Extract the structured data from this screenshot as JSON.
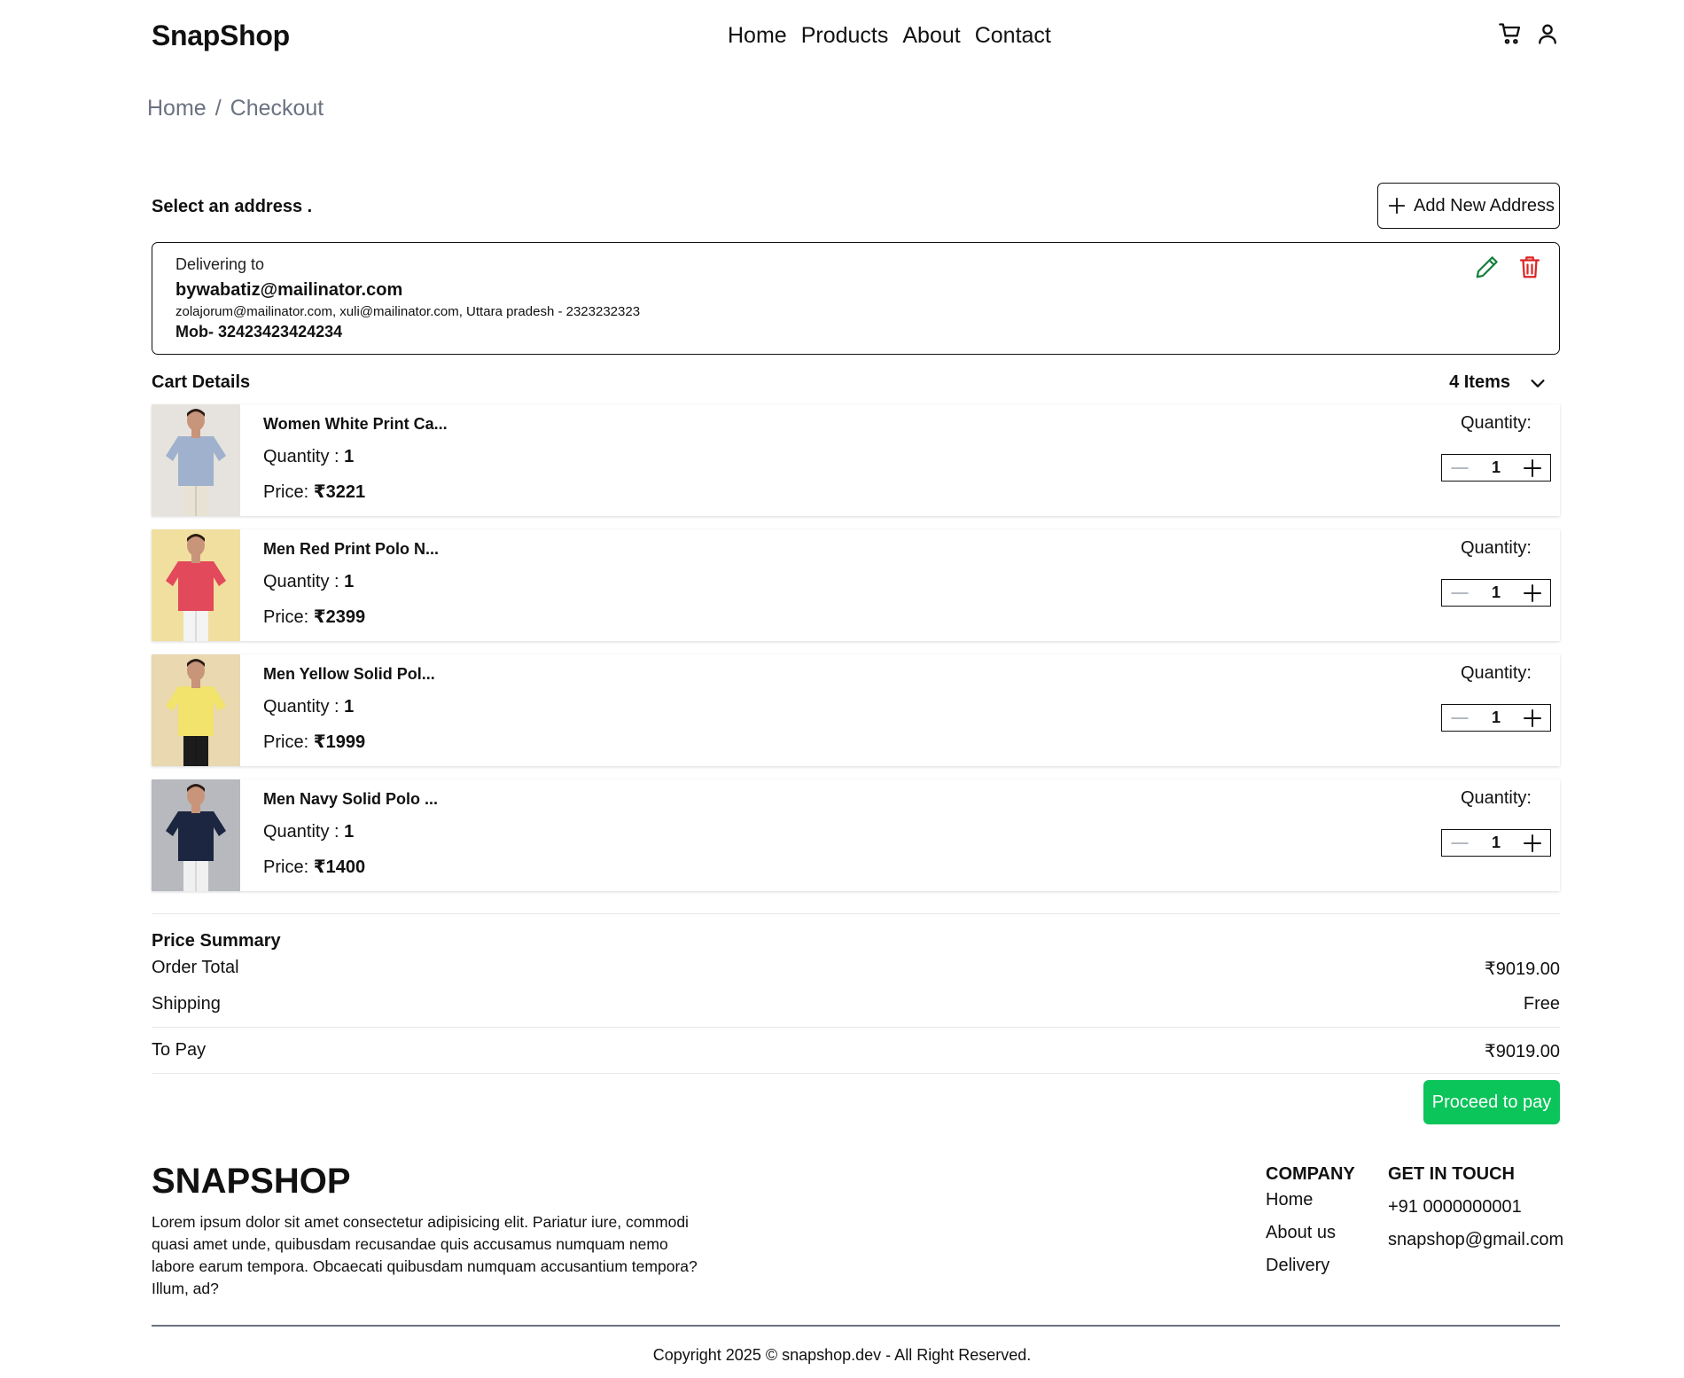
{
  "header": {
    "logo": "SnapShop",
    "nav": [
      "Home",
      "Products",
      "About",
      "Contact"
    ],
    "icons": [
      "cart-icon",
      "user-icon"
    ]
  },
  "breadcrumb": {
    "home": "Home",
    "sep": "/",
    "current": "Checkout"
  },
  "address": {
    "section_title": "Select an address .",
    "add_button": "Add New Address",
    "label": "Delivering to",
    "email": "bywabatiz@mailinator.com",
    "line": "zolajorum@mailinator.com, xuli@mailinator.com, Uttara pradesh - 2323232323",
    "mobile": "Mob- 32423423424234",
    "edit_color": "#15803d",
    "delete_color": "#dc2626"
  },
  "cart": {
    "title": "Cart Details",
    "count": "4 Items",
    "quantity_label": "Quantity:",
    "items": [
      {
        "name": "Women White Print Ca...",
        "qty_label": "Quantity : ",
        "qty": "1",
        "price_label": "Price: ",
        "price": "₹3221",
        "stepper": "1",
        "shirt": "#9fb1cc",
        "bg": "#e6e3de",
        "pants": "#e8e2d4"
      },
      {
        "name": "Men Red Print Polo N...",
        "qty_label": "Quantity : ",
        "qty": "1",
        "price_label": "Price: ",
        "price": "₹2399",
        "stepper": "1",
        "shirt": "#e2495a",
        "bg": "#f1dfa0",
        "pants": "#f3f3f3"
      },
      {
        "name": "Men Yellow Solid Pol...",
        "qty_label": "Quantity : ",
        "qty": "1",
        "price_label": "Price: ",
        "price": "₹1999",
        "stepper": "1",
        "shirt": "#f2e36c",
        "bg": "#e9d8b0",
        "pants": "#1b1b1b"
      },
      {
        "name": "Men Navy Solid Polo ...",
        "qty_label": "Quantity : ",
        "qty": "1",
        "price_label": "Price: ",
        "price": "₹1400",
        "stepper": "1",
        "shirt": "#1d2640",
        "bg": "#b7b9be",
        "pants": "#f0f0f0"
      }
    ]
  },
  "summary": {
    "title": "Price Summary",
    "order_total_label": "Order Total",
    "order_total": "₹9019.00",
    "shipping_label": "Shipping",
    "shipping": "Free",
    "to_pay_label": "To Pay",
    "to_pay": "₹9019.00",
    "pay_button": "Proceed to pay",
    "pay_color": "#0bc45a"
  },
  "footer": {
    "brand": "SNAPSHOP",
    "description": "Lorem ipsum dolor sit amet consectetur adipisicing elit. Pariatur iure, commodi quasi amet unde, quibusdam recusandae quis accusamus numquam nemo labore earum tempora. Obcaecati quibusdam numquam accusantium tempora? Illum, ad?",
    "company_title": "COMPANY",
    "company_links": [
      "Home",
      "About us",
      "Delivery"
    ],
    "contact_title": "GET IN TOUCH",
    "phone": "+91 0000000001",
    "email": "snapshop@gmail.com",
    "copyright": "Copyright 2025 © snapshop.dev - All Right Reserved."
  }
}
